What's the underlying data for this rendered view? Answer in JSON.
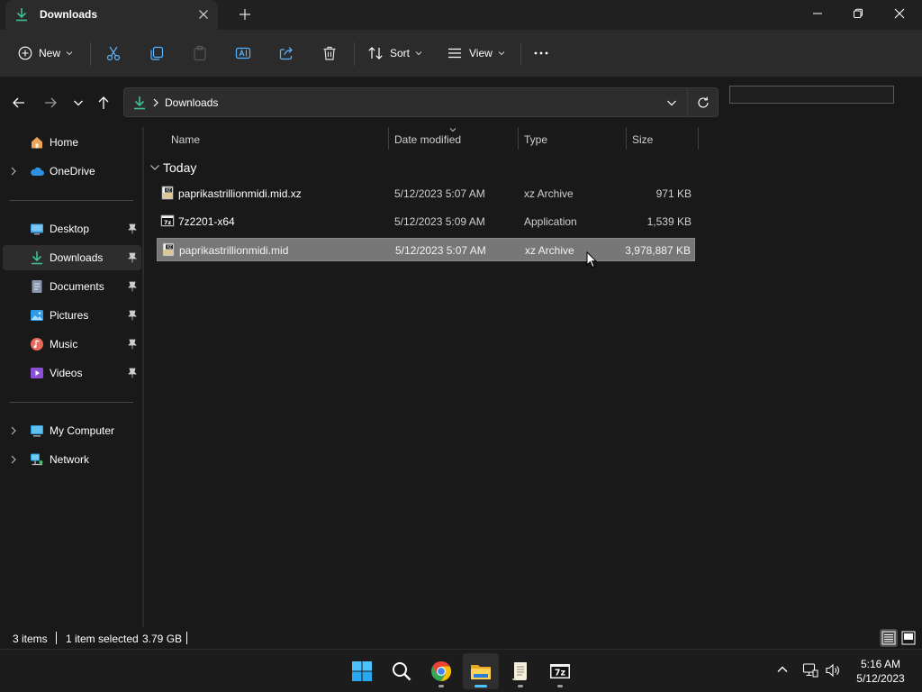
{
  "window": {
    "tab_title": "Downloads",
    "tab_icon": "download-arrow-icon"
  },
  "toolbar": {
    "new_label": "New",
    "sort_label": "Sort",
    "view_label": "View",
    "icons": [
      "plus-circle-icon",
      "cut-icon",
      "copy-icon",
      "paste-icon",
      "rename-icon",
      "share-icon",
      "delete-icon",
      "sort-icon",
      "view-icon",
      "more-icon"
    ]
  },
  "address": {
    "path": "Downloads",
    "search_placeholder": ""
  },
  "sidebar": {
    "items": [
      {
        "label": "Home",
        "icon": "home-icon",
        "expandable": false,
        "pinned": false
      },
      {
        "label": "OneDrive",
        "icon": "cloud-icon",
        "expandable": true,
        "pinned": false
      },
      {
        "label": "Desktop",
        "icon": "desktop-icon",
        "expandable": false,
        "pinned": true
      },
      {
        "label": "Downloads",
        "icon": "download-arrow-icon",
        "expandable": false,
        "pinned": true,
        "active": true
      },
      {
        "label": "Documents",
        "icon": "document-icon",
        "expandable": false,
        "pinned": true
      },
      {
        "label": "Pictures",
        "icon": "picture-icon",
        "expandable": false,
        "pinned": true
      },
      {
        "label": "Music",
        "icon": "music-icon",
        "expandable": false,
        "pinned": true
      },
      {
        "label": "Videos",
        "icon": "video-icon",
        "expandable": false,
        "pinned": true
      },
      {
        "label": "My Computer",
        "icon": "computer-icon",
        "expandable": true,
        "pinned": false
      },
      {
        "label": "Network",
        "icon": "network-icon",
        "expandable": true,
        "pinned": false
      }
    ]
  },
  "columns": {
    "name": "Name",
    "date": "Date modified",
    "type": "Type",
    "size": "Size"
  },
  "group": {
    "label": "Today"
  },
  "files": [
    {
      "name": "paprikastrillionmidi.mid.xz",
      "date": "5/12/2023 5:07 AM",
      "type": "xz Archive",
      "size": "971 KB",
      "icon": "archive-file-icon",
      "selected": false
    },
    {
      "name": "7z2201-x64",
      "date": "5/12/2023 5:09 AM",
      "type": "Application",
      "size": "1,539 KB",
      "icon": "7zip-app-icon",
      "selected": false
    },
    {
      "name": "paprikastrillionmidi.mid",
      "date": "5/12/2023 5:07 AM",
      "type": "xz Archive",
      "size": "3,978,887 KB",
      "icon": "archive-file-icon",
      "selected": true
    }
  ],
  "status": {
    "items": "3 items",
    "selection": "1 item selected",
    "selection_size": "3.79 GB"
  },
  "taskbar": {
    "apps": [
      "windows-start-icon",
      "search-icon",
      "chrome-icon",
      "file-explorer-icon",
      "notepad-icon",
      "7zip-icon"
    ],
    "time": "5:16 AM",
    "date": "5/12/2023"
  },
  "colors": {
    "accent": "#4cc2ff",
    "download_green": "#3fbf8f",
    "selected_row": "#777777"
  }
}
